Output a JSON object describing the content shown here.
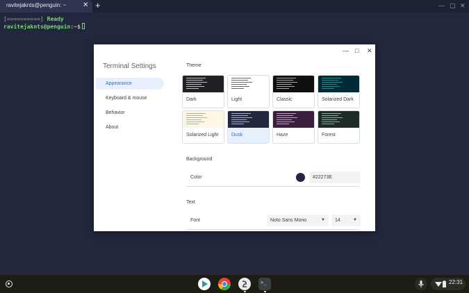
{
  "tab": {
    "title": "ravitejaknts@penguin: ~",
    "close": "✕",
    "new_tab": "+"
  },
  "window_controls": {
    "minimize": "—",
    "maximize": "▢",
    "close": "✕"
  },
  "terminal": {
    "progress": "[==========]",
    "status": "Ready",
    "user_host": "ravitejaknts@penguin",
    "path": ":~$"
  },
  "dialog": {
    "title": "Terminal Settings",
    "controls": {
      "minimize": "—",
      "maximize": "□",
      "close": "✕"
    },
    "nav": [
      {
        "label": "Appearance",
        "active": true
      },
      {
        "label": "Keyboard & mouse",
        "active": false
      },
      {
        "label": "Behavior",
        "active": false
      },
      {
        "label": "About",
        "active": false
      }
    ],
    "theme_section": "Theme",
    "themes": [
      {
        "name": "Dark",
        "bg": "#202124",
        "fg": "#e8eaed",
        "selected": false
      },
      {
        "name": "Light",
        "bg": "#ffffff",
        "fg": "#3c4043",
        "selected": false
      },
      {
        "name": "Classic",
        "bg": "#101010",
        "fg": "#d0d0d0",
        "selected": false
      },
      {
        "name": "Solarized Dark",
        "bg": "#002b36",
        "fg": "#2aa198",
        "selected": false
      },
      {
        "name": "Solarized Light",
        "bg": "#fdf6e3",
        "fg": "#93a1a1",
        "selected": false
      },
      {
        "name": "Dusk",
        "bg": "#22273E",
        "fg": "#d0d4f0",
        "selected": true
      },
      {
        "name": "Haze",
        "bg": "#3c1f3f",
        "fg": "#e0c0e8",
        "selected": false
      },
      {
        "name": "Forest",
        "bg": "#1f2b26",
        "fg": "#a8d0b8",
        "selected": false
      }
    ],
    "background_section": "Background",
    "color_label": "Color",
    "color_value": "#22273E",
    "text_section": "Text",
    "font_label": "Font",
    "font_value": "Noto Sans Mono",
    "font_size_value": "14",
    "select_arrow": "▼"
  },
  "shelf": {
    "apps": [
      {
        "name": "play-store",
        "color": "#34a853"
      },
      {
        "name": "chrome",
        "color": "#ea4335"
      },
      {
        "name": "steam-like",
        "color": "#e8eaed"
      },
      {
        "name": "terminal",
        "color": "#3c4043"
      }
    ],
    "clock": "22:31",
    "terminal_glyph": ">_"
  }
}
